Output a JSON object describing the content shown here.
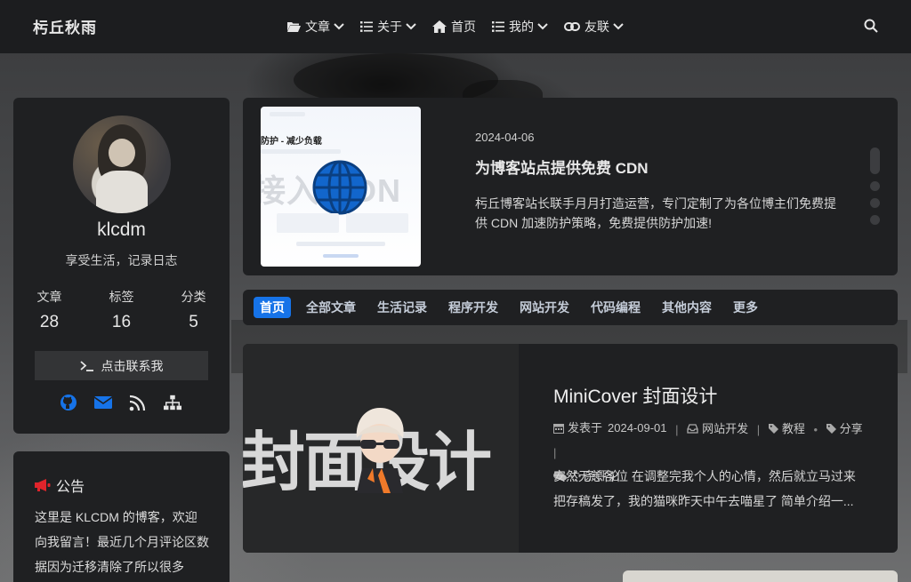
{
  "navbar": {
    "brand": "杇丘秋雨",
    "items": [
      {
        "label": "文章",
        "icon": "folder-open-icon",
        "dropdown": true
      },
      {
        "label": "关于",
        "icon": "list-icon",
        "dropdown": true
      },
      {
        "label": "首页",
        "icon": "home-icon",
        "dropdown": false
      },
      {
        "label": "我的",
        "icon": "list-icon",
        "dropdown": true
      },
      {
        "label": "友联",
        "icon": "link-icon",
        "dropdown": true
      }
    ],
    "search_icon": "search-icon"
  },
  "profile": {
    "username": "klcdm",
    "motto": "享受生活，记录日志",
    "stats": [
      {
        "label": "文章",
        "value": "28"
      },
      {
        "label": "标签",
        "value": "16"
      },
      {
        "label": "分类",
        "value": "5"
      }
    ],
    "contact_label": "点击联系我",
    "socials": [
      "github-icon",
      "mail-icon",
      "rss-icon",
      "sitemap-icon"
    ],
    "social_color": "#1673e8"
  },
  "notice": {
    "title": "公告",
    "icon": "bullhorn-icon",
    "icon_color": "#e0242b",
    "text": "这里是 KLCDM 的博客，欢迎向我留言！最近几个月评论区数据因为迁移清除了所以很多"
  },
  "featured": {
    "date": "2024-04-06",
    "title": "为博客站点提供免费 CDN",
    "description": "杇丘博客站长联手月月打造运营，专门定制了为各位博主们免费提供 CDN 加速防护策略，免费提供防护加速!",
    "image_text_top": "防护 - 减少负载",
    "image_text_big": "接入 CDN",
    "slides": 4,
    "active_slide": 1
  },
  "tabs": [
    "首页",
    "全部文章",
    "生活记录",
    "程序开发",
    "网站开发",
    "代码编程",
    "其他内容",
    "更多"
  ],
  "accent_color": "#1673e8",
  "post": {
    "title": "MiniCover 封面设计",
    "cover_text": "封面设计",
    "published_label": "发表于",
    "date": "2024-09-01",
    "category": "网站开发",
    "tags": [
      "教程",
      "分享"
    ],
    "comments_label": "条评论",
    "excerpt": "安然无恙各位 在调整完我个人的心情，然后就立马过来把存稿发了，我的猫咪昨天中午去喵星了 简单介绍一..."
  }
}
